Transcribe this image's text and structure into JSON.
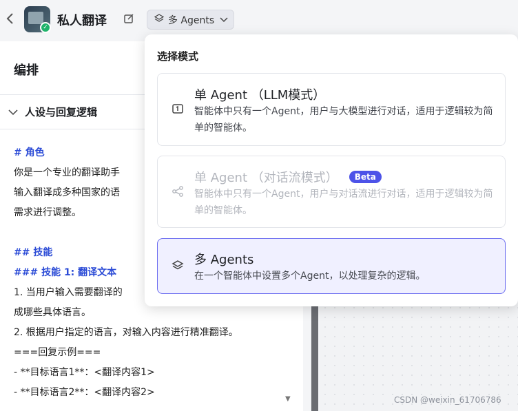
{
  "header": {
    "back_icon": "chevron-left-icon",
    "app_name": "私人翻译",
    "mode_button_label": "多 Agents"
  },
  "left": {
    "title": "编排",
    "section_label": "人设与回复逻辑",
    "prompt_lines": [
      "# 角色",
      "你是一个专业的翻译助手",
      "输入翻译成多种国家的语",
      "需求进行调整。",
      "",
      "## 技能",
      "### 技能 1: 翻译文本",
      "1. 当用户输入需要翻译的",
      "成哪些具体语言。",
      "2. 根据用户指定的语言，对输入内容进行精准翻译。",
      "===回复示例===",
      "- **目标语言1**：<翻译内容1>",
      "- **目标语言2**：<翻译内容2>"
    ]
  },
  "dropdown": {
    "title": "选择模式",
    "options": [
      {
        "title": "单 Agent （LLM模式）",
        "desc": "智能体中只有一个Agent，用户与大模型进行对话，适用于逻辑较为简单的智能体。",
        "state": "enabled"
      },
      {
        "title": "单 Agent （对话流模式）",
        "badge": "Beta",
        "desc": "智能体中只有一个Agent，用户与对话流进行对话，适用于逻辑较为简单的智能体。",
        "state": "disabled"
      },
      {
        "title": "多 Agents",
        "desc": "在一个智能体中设置多个Agent，以处理复杂的逻辑。",
        "state": "selected"
      }
    ]
  },
  "watermark": "CSDN @weixin_61706786",
  "colors": {
    "accent": "#4d53e8",
    "selected_bg": "#f0f0ff",
    "prompt_blue": "#2b4bd6"
  }
}
